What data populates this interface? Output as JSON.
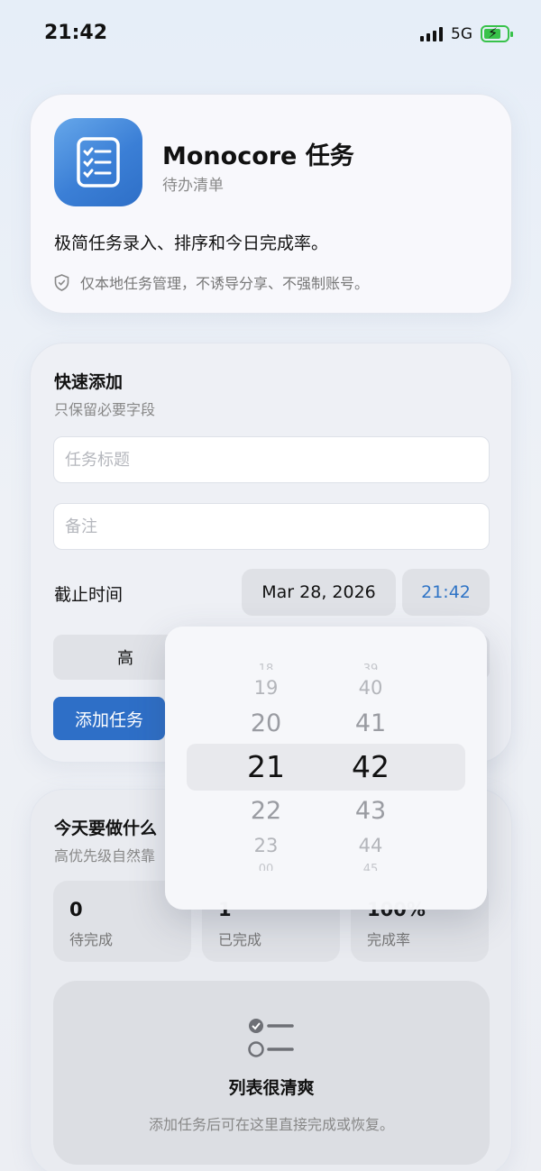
{
  "status_bar": {
    "time": "21:42",
    "network": "5G"
  },
  "app": {
    "title": "Monocore 任务",
    "subtitle": "待办清单",
    "tagline": "极简任务录入、排序和今日完成率。",
    "privacy_note": "仅本地任务管理，不诱导分享、不强制账号。"
  },
  "quick_add": {
    "title": "快速添加",
    "subtitle": "只保留必要字段",
    "task_title_placeholder": "任务标题",
    "note_placeholder": "备注",
    "due_label": "截止时间",
    "due_date": "Mar 28, 2026",
    "due_time": "21:42",
    "priority_selected": "高",
    "add_button": "添加任务"
  },
  "today": {
    "title": "今天要做什么",
    "subtitle": "高优先级自然靠",
    "stats": [
      {
        "value": "0",
        "label": "待完成"
      },
      {
        "value": "1",
        "label": "已完成"
      },
      {
        "value": "100%",
        "label": "完成率"
      }
    ],
    "empty_title": "列表很清爽",
    "empty_subtitle": "添加任务后可在这里直接完成或恢复。"
  },
  "time_picker": {
    "hours": [
      "18",
      "19",
      "20",
      "21",
      "22",
      "23",
      "00"
    ],
    "minutes": [
      "39",
      "40",
      "41",
      "42",
      "43",
      "44",
      "45"
    ],
    "selected_hour": "21",
    "selected_minute": "42"
  }
}
